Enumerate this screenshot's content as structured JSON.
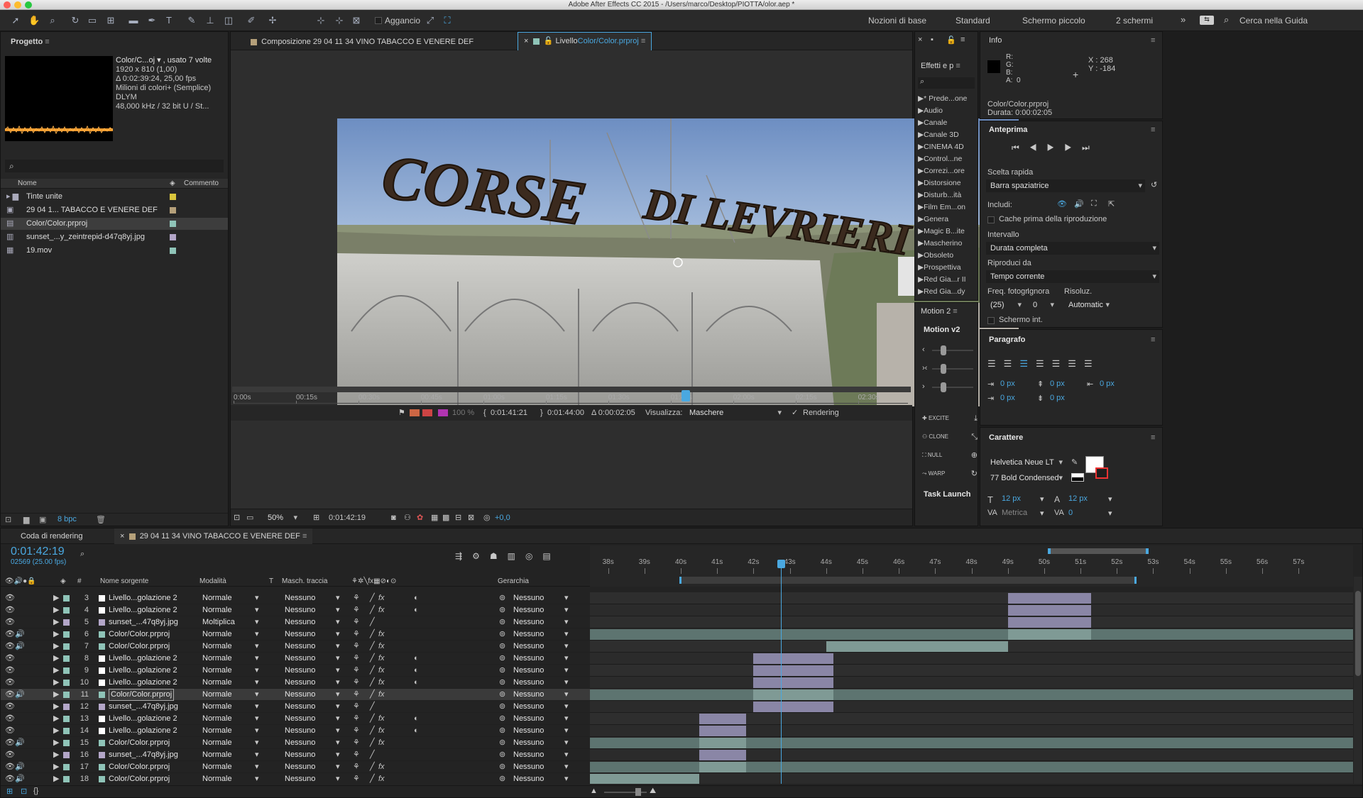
{
  "app": {
    "title": "Adobe After Effects CC 2015 - /Users/marco/Desktop/PIOTTA/olor.aep *"
  },
  "toolbar": {
    "snap_label": "Aggancio",
    "workspaces": [
      "Nozioni di base",
      "Standard",
      "Schermo piccolo",
      "2 schermi"
    ],
    "search_help": "Cerca nella Guida"
  },
  "project": {
    "title": "Progetto",
    "item_name": "Color/C...oj ▾ , usato 7 volte",
    "dims": "1920 x 810 (1,00)",
    "duration": "Δ 0:02:39:24, 25,00 fps",
    "colors": "Milioni di colori+ (Semplice)",
    "codec": "DLYM",
    "audio": "48,000 kHz / 32 bit U / St...",
    "col_name": "Nome",
    "col_comment": "Commento",
    "items": [
      {
        "name": "Tinte unite",
        "icon": "folder-icon",
        "color": "#d9c53c"
      },
      {
        "name": "29 04 1... TABACCO E VENERE DEF",
        "icon": "composition-icon",
        "color": "#b5a07a"
      },
      {
        "name": "Color/Color.prproj",
        "icon": "premiere-project-icon",
        "color": "#8fc4b8"
      },
      {
        "name": "sunset_...y_zeintrepid-d47q8yj.jpg",
        "icon": "image-file-icon",
        "color": "#b3a6c8"
      },
      {
        "name": "19.mov",
        "icon": "video-file-icon",
        "color": "#8fc4b8"
      }
    ],
    "bpc": "8 bpc"
  },
  "viewer": {
    "tab_comp": "Composizione 29 04 11 34 VINO TABACCO E VENERE DEF",
    "tab_layer_prefix": "Livello",
    "tab_layer_name": "Color/Color.prproj",
    "ruler": [
      "0:00s",
      "00:15s",
      "00:30s",
      "00:45s",
      "01:00s",
      "01:15s",
      "01:30s",
      "01:45s",
      "02:00s",
      "02:15s",
      "02:30s"
    ],
    "in_time": "0:01:41:21",
    "out_time": "0:01:44:00",
    "duration": "Δ 0:00:02:05",
    "view_label": "Visualizza:",
    "view_value": "Maschere",
    "rendering": "Rendering",
    "zoom": "50%",
    "current_time": "0:01:42:19",
    "exposure": "+0,0",
    "opacity": "100 %",
    "playhead_fraction": 0.67
  },
  "effects": {
    "title": "Effetti e p",
    "search_placeholder": "",
    "items": [
      "* Prede...one",
      "Audio",
      "Canale",
      "Canale 3D",
      "CINEMA 4D",
      "Control...ne",
      "Correzi...ore",
      "Distorsione",
      "Disturb...ità",
      "Film Em...on",
      "Genera",
      "Magic B...ite",
      "Mascherino",
      "Obsoleto",
      "Prospettiva",
      "Red Gia...r II",
      "Red Gia...dy"
    ]
  },
  "motion": {
    "tab": "Motion 2",
    "title": "Motion v2",
    "buttons": [
      "EXCITE",
      "CLONE",
      "NULL",
      "WARP"
    ],
    "task_launch": "Task Launch"
  },
  "info": {
    "title": "Info",
    "r": "R:",
    "g": "G:",
    "b": "B:",
    "a": "A:",
    "a_val": "0",
    "x": "X : 268",
    "y": "Y : -184",
    "file": "Color/Color.prproj",
    "duration": "Durata: 0:00:02:05"
  },
  "preview": {
    "title": "Anteprima",
    "shortcut_label": "Scelta rapida",
    "shortcut_value": "Barra spaziatrice",
    "include_label": "Includi:",
    "cache_label": "Cache prima della riproduzione",
    "range_label": "Intervallo",
    "range_value": "Durata completa",
    "play_from_label": "Riproduci da",
    "play_from_value": "Tempo corrente",
    "fps_label": "Freq. fotogr.",
    "skip_label": "Ignora",
    "res_label": "Risoluz.",
    "fps_value": "(25)",
    "skip_value": "0",
    "res_value": "Automatic",
    "fullscreen_label": "Schermo int."
  },
  "paragraph": {
    "title": "Paragrafo",
    "indent_left": "0 px",
    "indent_right": "0 px",
    "space_before": "0 px",
    "space_after": "0 px",
    "indent_first": "0 px"
  },
  "character": {
    "title": "Carattere",
    "font": "Helvetica Neue LT",
    "style": "77 Bold Condensed",
    "size": "12 px",
    "leading": "12 px",
    "kerning": "Metrica",
    "tracking": "0"
  },
  "timeline": {
    "tab_render": "Coda di rendering",
    "tab_comp": "29 04 11 34 VINO TABACCO E VENERE DEF",
    "timecode": "0:01:42:19",
    "frames": "02569 (25.00 fps)",
    "col_num": "#",
    "col_source": "Nome sorgente",
    "col_mode": "Modalità",
    "col_t": "T",
    "col_mask": "Masch. traccia",
    "col_parent": "Gerarchia",
    "ruler": [
      "38s",
      "39s",
      "40s",
      "41s",
      "42s",
      "43s",
      "44s",
      "45s",
      "46s",
      "47s",
      "48s",
      "49s",
      "50s",
      "51s",
      "52s",
      "53s",
      "54s",
      "55s",
      "56s",
      "57s"
    ],
    "layers": [
      {
        "num": "3",
        "name": "Livello...golazione 2",
        "mode": "Normale",
        "mask": "Nessuno",
        "parent": "Nessuno",
        "color": "#ffffff",
        "type": "adjustment"
      },
      {
        "num": "4",
        "name": "Livello...golazione 2",
        "mode": "Normale",
        "mask": "Nessuno",
        "parent": "Nessuno",
        "color": "#ffffff",
        "type": "adjustment"
      },
      {
        "num": "5",
        "name": "sunset_...47q8yj.jpg",
        "mode": "Moltiplica",
        "mask": "Nessuno",
        "parent": "Nessuno",
        "color": "#b3a6c8",
        "type": "image"
      },
      {
        "num": "6",
        "name": "Color/Color.prproj",
        "mode": "Normale",
        "mask": "Nessuno",
        "parent": "Nessuno",
        "color": "#8fc4b8",
        "type": "premiere"
      },
      {
        "num": "7",
        "name": "Color/Color.prproj",
        "mode": "Normale",
        "mask": "Nessuno",
        "parent": "Nessuno",
        "color": "#8fc4b8",
        "type": "premiere"
      },
      {
        "num": "8",
        "name": "Livello...golazione 2",
        "mode": "Normale",
        "mask": "Nessuno",
        "parent": "Nessuno",
        "color": "#ffffff",
        "type": "adjustment"
      },
      {
        "num": "9",
        "name": "Livello...golazione 2",
        "mode": "Normale",
        "mask": "Nessuno",
        "parent": "Nessuno",
        "color": "#ffffff",
        "type": "adjustment"
      },
      {
        "num": "10",
        "name": "Livello...golazione 2",
        "mode": "Normale",
        "mask": "Nessuno",
        "parent": "Nessuno",
        "color": "#ffffff",
        "type": "adjustment"
      },
      {
        "num": "11",
        "name": "Color/Color.prproj",
        "mode": "Normale",
        "mask": "Nessuno",
        "parent": "Nessuno",
        "color": "#8fc4b8",
        "type": "premiere",
        "selected": true
      },
      {
        "num": "12",
        "name": "sunset_...47q8yj.jpg",
        "mode": "Normale",
        "mask": "Nessuno",
        "parent": "Nessuno",
        "color": "#b3a6c8",
        "type": "image"
      },
      {
        "num": "13",
        "name": "Livello...golazione 2",
        "mode": "Normale",
        "mask": "Nessuno",
        "parent": "Nessuno",
        "color": "#ffffff",
        "type": "adjustment"
      },
      {
        "num": "14",
        "name": "Livello...golazione 2",
        "mode": "Normale",
        "mask": "Nessuno",
        "parent": "Nessuno",
        "color": "#ffffff",
        "type": "adjustment"
      },
      {
        "num": "15",
        "name": "Color/Color.prproj",
        "mode": "Normale",
        "mask": "Nessuno",
        "parent": "Nessuno",
        "color": "#8fc4b8",
        "type": "premiere"
      },
      {
        "num": "16",
        "name": "sunset_...47q8yj.jpg",
        "mode": "Normale",
        "mask": "Nessuno",
        "parent": "Nessuno",
        "color": "#b3a6c8",
        "type": "image"
      },
      {
        "num": "17",
        "name": "Color/Color.prproj",
        "mode": "Normale",
        "mask": "Nessuno",
        "parent": "Nessuno",
        "color": "#8fc4b8",
        "type": "premiere"
      },
      {
        "num": "18",
        "name": "Color/Color.prproj",
        "mode": "Normale",
        "mask": "Nessuno",
        "parent": "Nessuno",
        "color": "#8fc4b8",
        "type": "premiere"
      }
    ],
    "clips": [
      {
        "row": 0,
        "start": 49.0,
        "end": 51.3,
        "color": "#8a86a6"
      },
      {
        "row": 1,
        "start": 49.0,
        "end": 51.3,
        "color": "#8a86a6"
      },
      {
        "row": 2,
        "start": 49.0,
        "end": 51.3,
        "color": "#8a86a6"
      },
      {
        "row": 3,
        "start": 37.5,
        "end": 58.5,
        "color": "#5d7470"
      },
      {
        "row": 3,
        "start": 49.0,
        "end": 51.3,
        "color": "#7f9a95"
      },
      {
        "row": 4,
        "start": 44.0,
        "end": 49.0,
        "color": "#7f9a95"
      },
      {
        "row": 5,
        "start": 42.0,
        "end": 44.2,
        "color": "#8a86a6"
      },
      {
        "row": 6,
        "start": 42.0,
        "end": 44.2,
        "color": "#8a86a6"
      },
      {
        "row": 7,
        "start": 42.0,
        "end": 44.2,
        "color": "#8a86a6"
      },
      {
        "row": 8,
        "start": 37.5,
        "end": 58.5,
        "color": "#5d7470"
      },
      {
        "row": 8,
        "start": 42.0,
        "end": 44.2,
        "color": "#7f9a95"
      },
      {
        "row": 9,
        "start": 42.0,
        "end": 44.2,
        "color": "#8a86a6"
      },
      {
        "row": 10,
        "start": 40.5,
        "end": 41.8,
        "color": "#8a86a6"
      },
      {
        "row": 11,
        "start": 40.5,
        "end": 41.8,
        "color": "#8a86a6"
      },
      {
        "row": 12,
        "start": 37.5,
        "end": 58.5,
        "color": "#5d7470"
      },
      {
        "row": 12,
        "start": 40.5,
        "end": 41.8,
        "color": "#7f9a95"
      },
      {
        "row": 13,
        "start": 40.5,
        "end": 41.8,
        "color": "#8a86a6"
      },
      {
        "row": 14,
        "start": 37.5,
        "end": 58.5,
        "color": "#5d7470"
      },
      {
        "row": 14,
        "start": 40.5,
        "end": 41.8,
        "color": "#7f9a95"
      },
      {
        "row": 15,
        "start": 37.5,
        "end": 40.5,
        "color": "#7f9a95"
      }
    ],
    "playhead_seconds": 42.76,
    "view_start": 37.5,
    "view_end": 58.5
  },
  "colors": {
    "accent": "#4aa8e0",
    "sky": "#8fb0d6",
    "panel": "#262626"
  }
}
